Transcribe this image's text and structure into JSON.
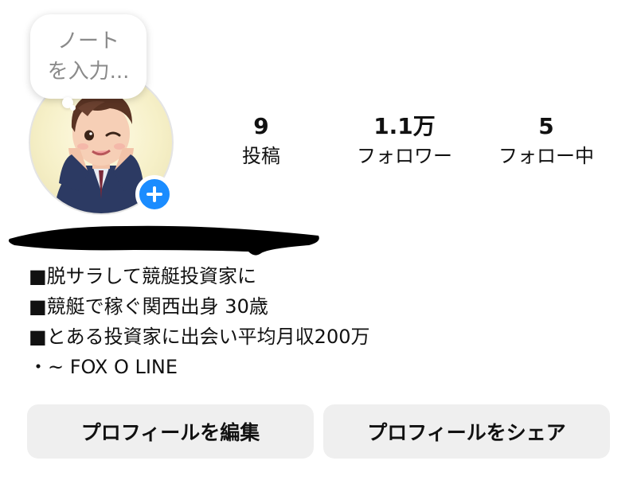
{
  "note": {
    "placeholder_line1": "ノート",
    "placeholder_line2": "を入力..."
  },
  "avatar": {
    "add_story_icon": "plus-icon",
    "accent_color": "#1a8cff"
  },
  "stats": {
    "posts": {
      "count": "9",
      "label": "投稿"
    },
    "followers": {
      "count": "1.1万",
      "label": "フォロワー"
    },
    "following": {
      "count": "5",
      "label": "フォロー中"
    }
  },
  "bio": {
    "lines": [
      "■脱サラして競艇投資家に",
      "■競艇で稼ぐ関西出身 30歳",
      "■とある投資家に出会い平均月収200万",
      "・~ FOX O LINE"
    ]
  },
  "actions": {
    "edit_profile": "プロフィールを編集",
    "share_profile": "プロフィールをシェア"
  }
}
